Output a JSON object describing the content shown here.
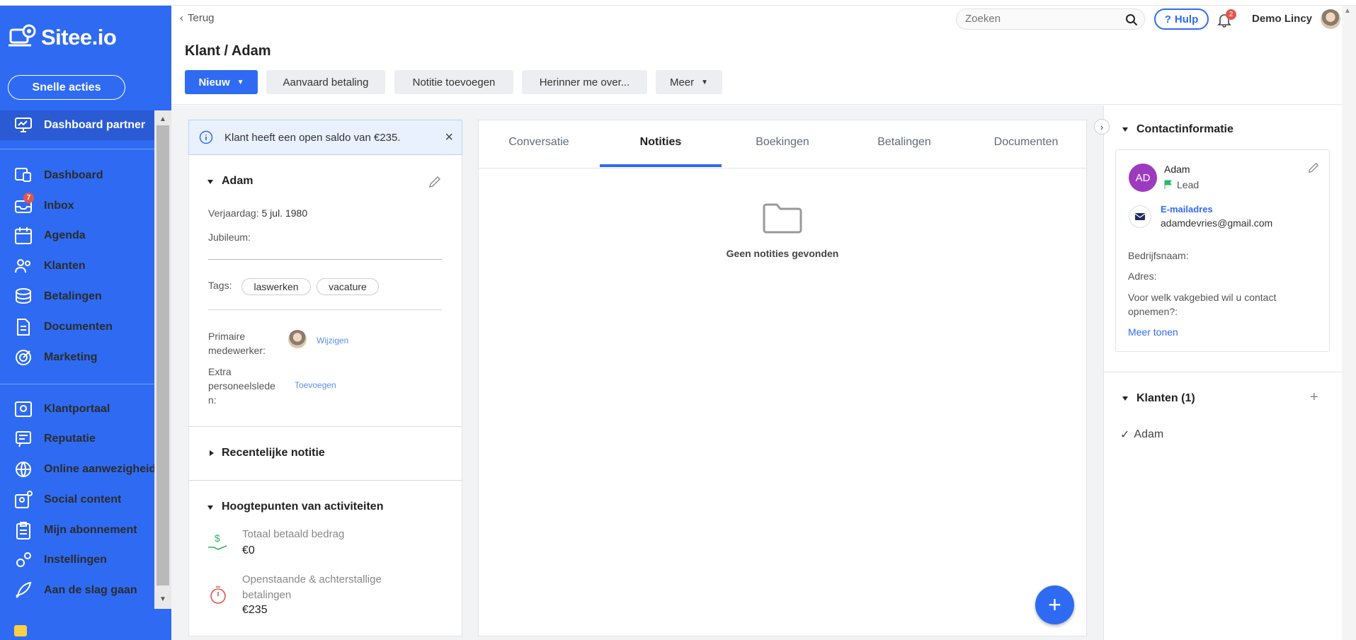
{
  "sidebar": {
    "logo": "Sitee.io",
    "quick_actions": "Snelle acties",
    "active_item": "Dashboard partner",
    "items": [
      {
        "label": "Dashboard",
        "icon": "dashboard-icon"
      },
      {
        "label": "Inbox",
        "icon": "inbox-icon",
        "badge": "7"
      },
      {
        "label": "Agenda",
        "icon": "calendar-icon"
      },
      {
        "label": "Klanten",
        "icon": "users-icon"
      },
      {
        "label": "Betalingen",
        "icon": "coins-icon"
      },
      {
        "label": "Documenten",
        "icon": "document-icon"
      },
      {
        "label": "Marketing",
        "icon": "target-icon"
      }
    ],
    "items2": [
      {
        "label": "Klantportaal",
        "icon": "portal-icon"
      },
      {
        "label": "Reputatie",
        "icon": "reputation-icon"
      },
      {
        "label": "Online aanwezigheid",
        "icon": "globe-icon"
      },
      {
        "label": "Social content",
        "icon": "social-icon"
      },
      {
        "label": "Mijn abonnement",
        "icon": "clipboard-icon"
      },
      {
        "label": "Instellingen",
        "icon": "settings-icon"
      },
      {
        "label": "Aan de slag gaan",
        "icon": "rocket-icon"
      }
    ]
  },
  "header": {
    "back": "Terug",
    "title": "Klant / Adam",
    "buttons": {
      "new": "Nieuw",
      "accept_payment": "Aanvaard betaling",
      "add_note": "Notitie toevoegen",
      "remind": "Herinner me over...",
      "more": "Meer"
    },
    "search_placeholder": "Zoeken",
    "help": "Hulp",
    "notif_count": "2",
    "user": "Demo Lincy"
  },
  "left": {
    "alert": "Klant heeft een open saldo van €235.",
    "name": "Adam",
    "birthday_label": "Verjaardag:",
    "birthday": "5 jul. 1980",
    "jubilee_label": "Jubileum:",
    "tags_label": "Tags:",
    "tags": [
      "laswerken",
      "vacature"
    ],
    "primary_label_1": "Primaire",
    "primary_label_2": "medewerker:",
    "change": "Wijzigen",
    "extra_label_1": "Extra",
    "extra_label_2": "personeelslede",
    "extra_label_3": "n:",
    "add": "Toevoegen",
    "recent_note": "Recentelijke notitie",
    "highlights": "Hoogtepunten van activiteiten",
    "total_paid_label": "Totaal betaald bedrag",
    "total_paid": "€0",
    "outstanding_label_1": "Openstaande & achterstallige",
    "outstanding_label_2": "betalingen",
    "outstanding": "€235"
  },
  "middle": {
    "tabs": [
      "Conversatie",
      "Notities",
      "Boekingen",
      "Betalingen",
      "Documenten"
    ],
    "active_tab": "Notities",
    "empty": "Geen notities gevonden"
  },
  "right": {
    "contact_title": "Contactinformatie",
    "initials": "AD",
    "name": "Adam",
    "status": "Lead",
    "email_label": "E-mailadres",
    "email": "adamdevries@gmail.com",
    "company_label": "Bedrijfsnaam:",
    "address_label": "Adres:",
    "question_1": "Voor welk vakgebied wil u contact",
    "question_2": "opnemen?:",
    "more": "Meer tonen",
    "clients_title": "Klanten (1)",
    "client": "Adam"
  },
  "colors": {
    "brand": "#2f6bf2",
    "badge": "#e2554a",
    "lead_flag": "#2fb56a",
    "avatar": "#9c3bbf"
  }
}
